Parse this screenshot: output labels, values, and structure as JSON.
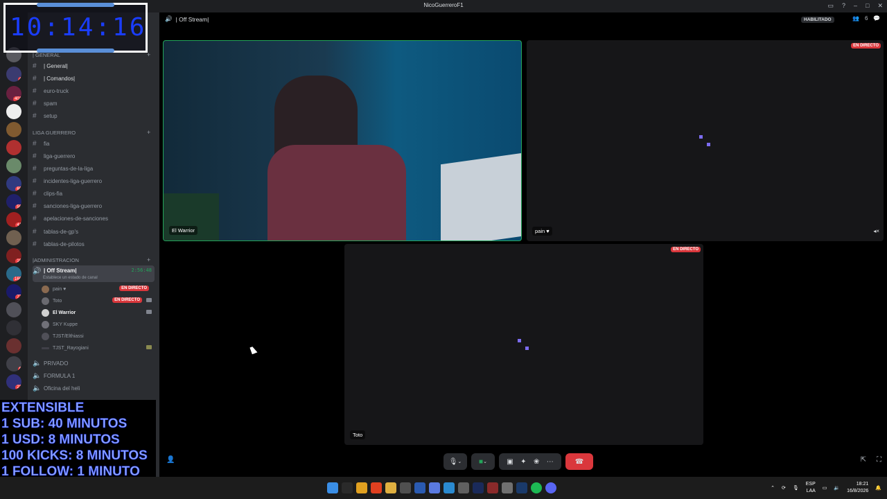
{
  "window": {
    "title": "NicoGuerreroF1"
  },
  "overlay": {
    "clock": "10:14:16",
    "extensible": [
      "EXTENSIBLE",
      "1 SUB: 40 MINUTOS",
      "1 USD: 8 MINUTOS",
      "100 KICKS: 8 MINUTOS",
      "1 FOLLOW: 1 MINUTO"
    ]
  },
  "servers": {
    "badges": [
      "4",
      "401",
      "60",
      "56",
      "41",
      "16",
      "166",
      "77",
      "9",
      "22"
    ]
  },
  "sidebar": {
    "categories": {
      "general": "| GENERAL",
      "liga": "LIGA GUERRERO",
      "admin": "|ADMINISTRACION"
    },
    "general_channels": [
      "| General|",
      "| Comandos|",
      "euro-truck",
      "spam",
      "setup"
    ],
    "liga_channels": [
      "fia",
      "liga-guerrero",
      "preguntas-de-la-liga",
      "incidentes-liga-guerrero",
      "clips-fia",
      "sanciones-liga-guerrero",
      "apelaciones-de-sanciones",
      "tablas-de-gp's",
      "tablas-de-pilotos"
    ],
    "voice_channel": {
      "name": "| Off Stream|",
      "status": "Establece un estado de canal",
      "timer": "2:56:48"
    },
    "voice_users": [
      {
        "name": "pain ♥",
        "live": "EN DIRECTO"
      },
      {
        "name": "Toto",
        "live": "EN DIRECTO"
      },
      {
        "name": "El Warrior",
        "live": ""
      },
      {
        "name": "SKY Kuppe",
        "live": ""
      },
      {
        "name": "TJST/Elthiassi",
        "live": ""
      },
      {
        "name": "TJST_Rayogiani",
        "live": ""
      }
    ],
    "other_voice": [
      "PRIVADO",
      "FORMULA 1",
      "Oficina del heli"
    ]
  },
  "header": {
    "channel": "| Off Stream|",
    "status": "HABILITADO",
    "members": "6"
  },
  "tiles": {
    "warrior": "El Warrior",
    "pain": "pain ♥",
    "toto": "Toto",
    "live_label": "EN DIRECTO"
  },
  "taskbar": {
    "lang": "ESP",
    "lang2": "LAA",
    "time": "18:21",
    "date": "16/8/2026"
  },
  "colors": {
    "accent_live": "#da373c",
    "speaking": "#23a55a",
    "clock": "#1a3dff"
  }
}
